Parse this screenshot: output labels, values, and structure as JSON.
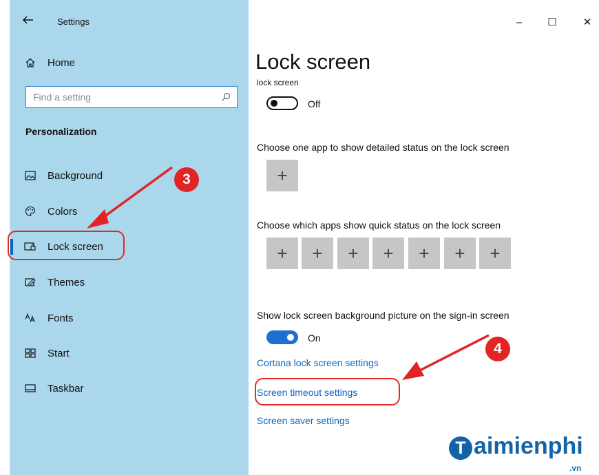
{
  "titlebar": {
    "back_icon": "arrow-left-icon",
    "title": "Settings",
    "minimize_label": "–",
    "maximize_label": "☐",
    "close_label": "✕"
  },
  "sidebar": {
    "home": {
      "label": "Home",
      "icon": "home-icon"
    },
    "search": {
      "placeholder": "Find a setting",
      "icon": "search-icon"
    },
    "section_title": "Personalization",
    "items": [
      {
        "label": "Background",
        "icon": "picture-icon"
      },
      {
        "label": "Colors",
        "icon": "palette-icon"
      },
      {
        "label": "Lock screen",
        "icon": "lock-screen-icon",
        "selected": true
      },
      {
        "label": "Themes",
        "icon": "themes-icon"
      },
      {
        "label": "Fonts",
        "icon": "fonts-icon"
      },
      {
        "label": "Start",
        "icon": "start-icon"
      },
      {
        "label": "Taskbar",
        "icon": "taskbar-icon"
      }
    ]
  },
  "main": {
    "title": "Lock screen",
    "clipped_text": "lock screen",
    "toggle1": {
      "state": "off",
      "label": "Off"
    },
    "detailed_status_desc": "Choose one app to show detailed status on the lock screen",
    "detailed_status_slots": [
      "+"
    ],
    "quick_status_desc": "Choose which apps show quick status on the lock screen",
    "quick_status_slots": [
      "+",
      "+",
      "+",
      "+",
      "+",
      "+",
      "+"
    ],
    "signin_desc": "Show lock screen background picture on the sign-in screen",
    "toggle2": {
      "state": "on",
      "label": "On"
    },
    "links": [
      "Cortana lock screen settings",
      "Screen timeout settings",
      "Screen saver settings"
    ]
  },
  "annotations": {
    "badge3": "3",
    "badge4": "4",
    "color": "#e12424"
  },
  "watermark": {
    "icon_letter": "T",
    "text": "aimienphi",
    "suffix": ".vn"
  },
  "colors": {
    "sidebar_bg": "#aad7ec",
    "accent": "#0067c0",
    "link": "#0a66c2",
    "toggle_on": "#1e6fd0",
    "tile_bg": "#c6c6c6"
  }
}
